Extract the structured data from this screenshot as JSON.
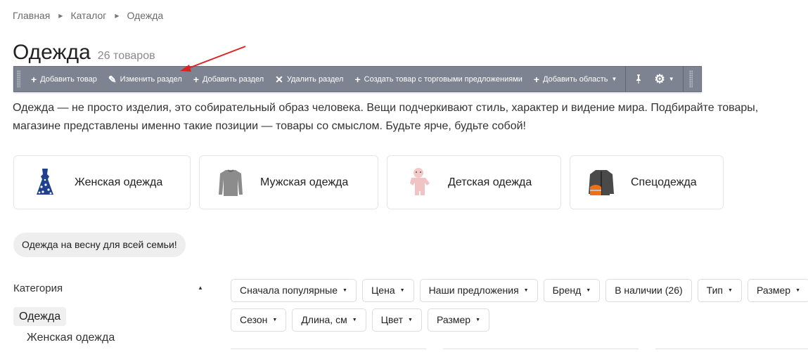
{
  "breadcrumb": [
    "Главная",
    "Каталог",
    "Одежда"
  ],
  "page": {
    "title": "Одежда",
    "count": "26 товаров"
  },
  "toolbar": {
    "add_product": "Добавить товар",
    "edit_section": "Изменить раздел",
    "add_section": "Добавить раздел",
    "delete_section": "Удалить раздел",
    "create_with_offers": "Создать товар с торговыми предложениями",
    "add_area": "Добавить область"
  },
  "description": {
    "line1": "Одежда — не просто изделия, это собирательный образ человека. Вещи подчеркивают стиль, характер и видение мира. Подбирайте товары,",
    "line2": "магазине представлены именно такие позиции — товары со смыслом. Будьте ярче, будьте собой!"
  },
  "categories": [
    {
      "label": "Женская одежда",
      "icon": "dress-icon"
    },
    {
      "label": "Мужская одежда",
      "icon": "sweater-icon"
    },
    {
      "label": "Детская одежда",
      "icon": "baby-onesie-icon"
    },
    {
      "label": "Спецодежда",
      "icon": "workwear-jacket-icon"
    }
  ],
  "tag": "Одежда на весну для всей семьи!",
  "sidebar": {
    "title": "Категория",
    "active": "Одежда",
    "item": "Женская одежда"
  },
  "filters": {
    "row1": [
      "Сначала популярные",
      "Цена",
      "Наши предложения",
      "Бренд",
      "В наличии (26)",
      "Тип",
      "Размер"
    ],
    "row2": [
      "Сезон",
      "Длина, см",
      "Цвет",
      "Размер"
    ]
  },
  "colors": {
    "toolbar_bg": "#7d8390",
    "arrow": "#e02020",
    "pill_bg": "#eeeeee"
  }
}
